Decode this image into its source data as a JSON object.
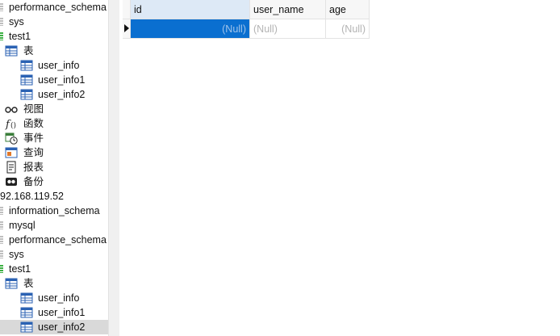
{
  "sidebar": {
    "items": [
      {
        "label": "performance_schema"
      },
      {
        "label": "sys"
      },
      {
        "label": "test1"
      },
      {
        "label": "表"
      },
      {
        "label": "user_info"
      },
      {
        "label": "user_info1"
      },
      {
        "label": "user_info2"
      },
      {
        "label": "视图"
      },
      {
        "label": "函数"
      },
      {
        "label": "事件"
      },
      {
        "label": "查询"
      },
      {
        "label": "报表"
      },
      {
        "label": "备份"
      },
      {
        "label": "92.168.119.52"
      },
      {
        "label": "information_schema"
      },
      {
        "label": "mysql"
      },
      {
        "label": "performance_schema"
      },
      {
        "label": "sys"
      },
      {
        "label": "test1"
      },
      {
        "label": "表"
      },
      {
        "label": "user_info"
      },
      {
        "label": "user_info1"
      },
      {
        "label": "user_info2"
      }
    ]
  },
  "grid": {
    "columns": [
      "id",
      "user_name",
      "age"
    ],
    "rows": [
      [
        "(Null)",
        "(Null)",
        "(Null)"
      ]
    ]
  },
  "colors": {
    "selected_cell": "#0a6fd0",
    "header_active": "#dde9f6",
    "db_open_green": "#3cb043"
  }
}
